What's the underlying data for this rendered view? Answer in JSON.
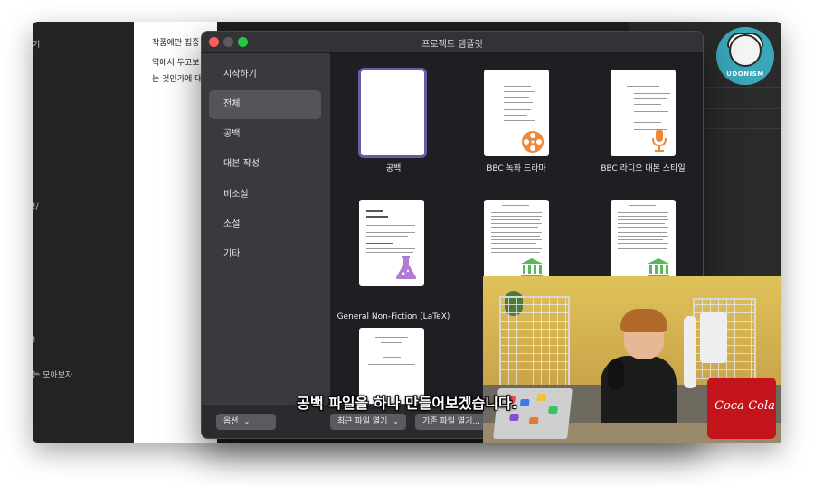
{
  "dialog": {
    "title": "프로젝트 템플릿",
    "categories": [
      {
        "label": "시작하기"
      },
      {
        "label": "전체"
      },
      {
        "label": "공백"
      },
      {
        "label": "대본 작성"
      },
      {
        "label": "비소설"
      },
      {
        "label": "소설"
      },
      {
        "label": "기타"
      }
    ],
    "selected_category": "전체",
    "templates": [
      {
        "label": "공백"
      },
      {
        "label": "BBC 녹화 드라마"
      },
      {
        "label": "BBC 라디오 대본 스타일"
      },
      {
        "label": "General Non-Fiction (LaTeX)"
      },
      {
        "label": ""
      },
      {
        "label": ""
      },
      {
        "label": ""
      }
    ],
    "footer": {
      "options_label": "옵션",
      "recent_label": "최근 파일 열기",
      "open_label": "기존 파일 열기..."
    }
  },
  "background": {
    "doc_lines": [
      "작품에만 집중",
      "역에서 두고보",
      "는 것인가에 대"
    ],
    "left_fragments": [
      "기",
      "!/",
      "!",
      "는 모아보자"
    ],
    "logo_text": "UDONISM"
  },
  "subtitle": "공백 파일을 하나 만들어보겠습니다.",
  "colors": {
    "selection_border": "#6b5aa8",
    "film_icon": "#f0883a",
    "mic_icon": "#f0883a",
    "flask_icon": "#b07ad6",
    "building_icon": "#5ab85a"
  }
}
